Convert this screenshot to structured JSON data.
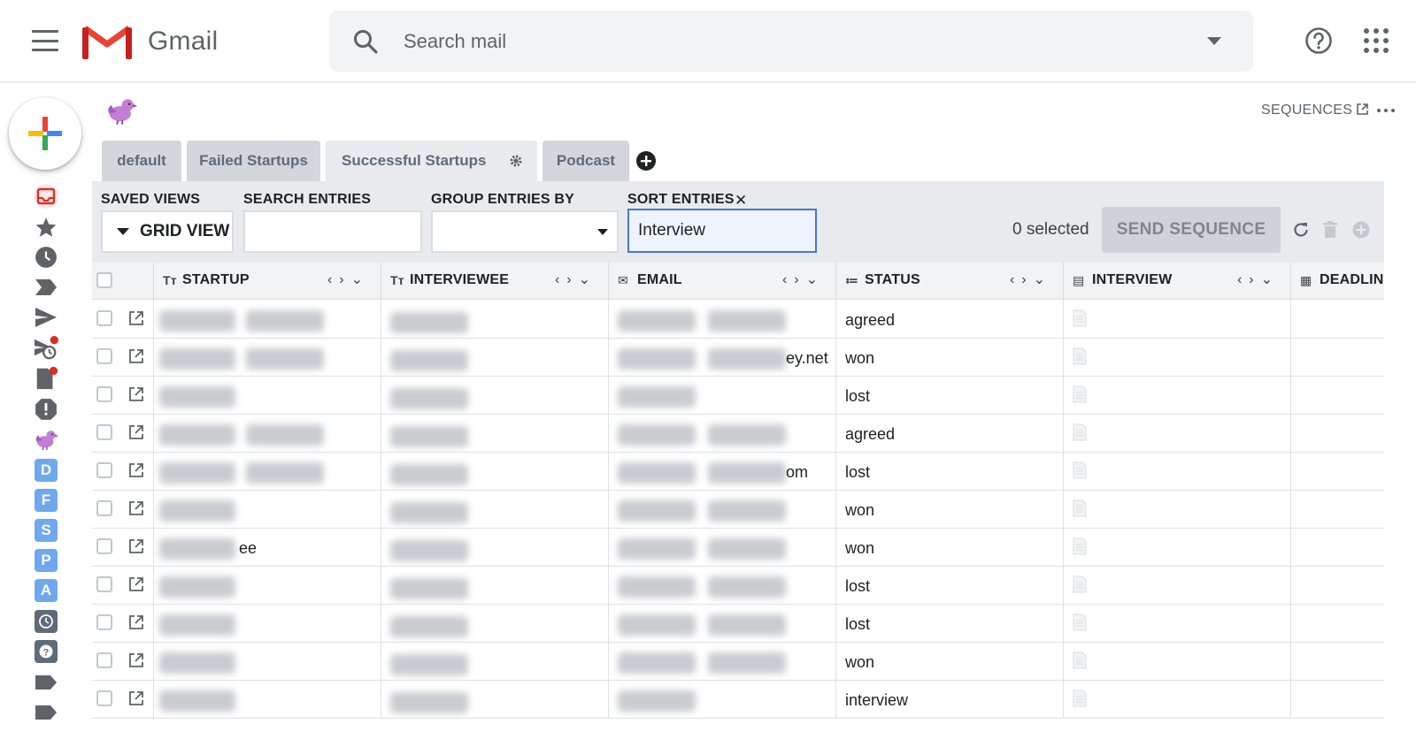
{
  "app": {
    "brand": "Gmail",
    "search_placeholder": "Search mail"
  },
  "icons": {
    "menu": "menu-icon",
    "search": "search-icon",
    "help": "help-icon",
    "apps": "apps-grid-icon"
  },
  "sidebar": {
    "compose": "compose-icon",
    "items": [
      {
        "name": "inbox",
        "icon": "inbox-icon"
      },
      {
        "name": "starred",
        "icon": "star-icon"
      },
      {
        "name": "snoozed",
        "icon": "clock-icon"
      },
      {
        "name": "important",
        "icon": "important-icon"
      },
      {
        "name": "sent",
        "icon": "send-icon"
      },
      {
        "name": "scheduled",
        "icon": "scheduled-icon"
      },
      {
        "name": "drafts",
        "icon": "draft-icon"
      },
      {
        "name": "spam",
        "icon": "spam-icon"
      },
      {
        "name": "streak",
        "icon": "bird-icon"
      }
    ],
    "letter_labels": [
      "D",
      "F",
      "S",
      "P",
      "A"
    ]
  },
  "extension": {
    "sequences_label": "SEQUENCES",
    "tabs": [
      {
        "label": "default",
        "active": false
      },
      {
        "label": "Failed Startups",
        "active": false
      },
      {
        "label": "Successful Startups",
        "active": true
      },
      {
        "label": "Podcast",
        "active": false
      }
    ]
  },
  "toolbar": {
    "saved_views_label": "SAVED VIEWS",
    "grid_view_label": "GRID VIEW",
    "search_entries_label": "SEARCH ENTRIES",
    "search_entries_value": "",
    "group_entries_label": "GROUP ENTRIES BY",
    "group_entries_value": "",
    "sort_entries_label": "SORT ENTRIES",
    "sort_clear": "✕",
    "sort_value": "Interview",
    "selected_count": "0 selected",
    "send_sequence_label": "SEND SEQUENCE"
  },
  "table": {
    "columns": [
      {
        "label": "STARTUP",
        "icon": "Tт",
        "controls": "‹›⌄"
      },
      {
        "label": "INTERVIEWEE",
        "icon": "Tт",
        "controls": "‹›⌄"
      },
      {
        "label": "EMAIL",
        "icon": "✉",
        "controls": "‹›⌄"
      },
      {
        "label": "STATUS",
        "icon": "≔",
        "controls": "‹›⌄"
      },
      {
        "label": "INTERVIEW",
        "icon": "▤",
        "controls": "‹›⌄"
      },
      {
        "label": "DEADLIN",
        "icon": "▦",
        "controls": ""
      }
    ],
    "rows": [
      {
        "startup_suffix": "",
        "email_suffix": "",
        "status": "agreed"
      },
      {
        "startup_suffix": "",
        "email_suffix": "ey.net",
        "status": "won"
      },
      {
        "startup_suffix": "",
        "email_suffix": "",
        "status": "lost"
      },
      {
        "startup_suffix": "",
        "email_suffix": "",
        "status": "agreed"
      },
      {
        "startup_suffix": "",
        "email_suffix": "om",
        "status": "lost"
      },
      {
        "startup_suffix": "",
        "email_suffix": "",
        "status": "won"
      },
      {
        "startup_suffix": "ee",
        "email_suffix": "",
        "status": "won"
      },
      {
        "startup_suffix": "",
        "email_suffix": "",
        "status": "lost"
      },
      {
        "startup_suffix": "",
        "email_suffix": "",
        "status": "lost"
      },
      {
        "startup_suffix": "",
        "email_suffix": "",
        "status": "won"
      },
      {
        "startup_suffix": "",
        "email_suffix": "",
        "status": "interview"
      }
    ]
  },
  "colors": {
    "gmail_red": "#ea4335",
    "accent_blue": "#4a72d8",
    "letter_label": "#6fa8ec",
    "notification_dot": "#d93025"
  }
}
